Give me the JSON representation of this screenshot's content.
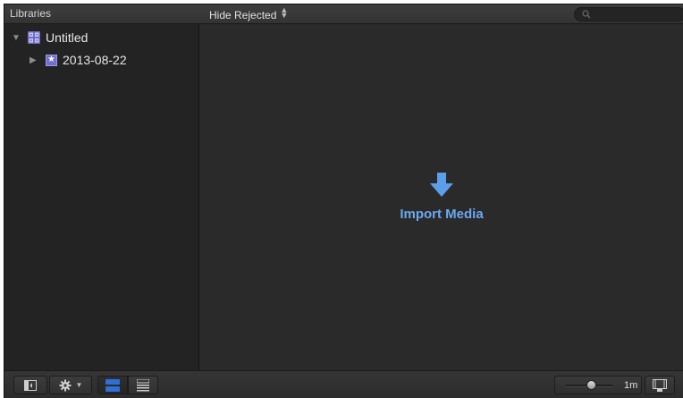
{
  "header": {
    "libraries_label": "Libraries",
    "filter_label": "Hide Rejected",
    "search_placeholder": "",
    "search_icon": "search-icon"
  },
  "sidebar": {
    "items": [
      {
        "label": "Untitled",
        "icon": "library-icon",
        "expanded": true
      },
      {
        "label": "2013-08-22",
        "icon": "event-star-icon",
        "expanded": false
      }
    ]
  },
  "browser": {
    "import_label": "Import Media",
    "import_icon": "down-arrow-icon",
    "accent_color": "#6aa8f0"
  },
  "toolbar": {
    "zoom_label": "1m",
    "zoom_level": 0.55,
    "buttons": [
      "sidebar-toggle-icon",
      "gear-icon",
      "filmstrip-view-icon",
      "list-view-icon",
      "clip-appearance-icon"
    ],
    "active_color": "#2f6fd6"
  }
}
